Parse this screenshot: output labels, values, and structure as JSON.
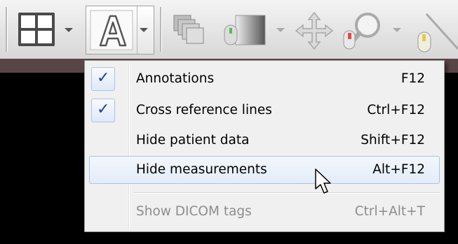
{
  "toolbar": {
    "layout_icon": "grid-layout-icon",
    "annotations_icon": "letter-a-icon",
    "stack_icon": "image-stack-icon",
    "window_level_icon": "window-level-icon",
    "pan_icon": "move-arrows-icon",
    "zoom_icon": "magnifier-icon",
    "measure_icon": "ruler-icon"
  },
  "menu": {
    "items": [
      {
        "label": "Annotations",
        "shortcut": "F12",
        "checked": true
      },
      {
        "label": "Cross reference lines",
        "shortcut": "Ctrl+F12",
        "checked": true
      },
      {
        "label": "Hide patient data",
        "shortcut": "Shift+F12",
        "checked": false
      },
      {
        "label": "Hide measurements",
        "shortcut": "Alt+F12",
        "checked": false,
        "hovered": true
      },
      {
        "label": "Show DICOM tags",
        "shortcut": "Ctrl+Alt+T",
        "checked": false,
        "disabled": true
      }
    ],
    "check_glyph": "✓"
  },
  "colors": {
    "accent_check": "#1d3ea8",
    "hover_border": "#a8c4e8",
    "disabled_text": "#8d8d8d"
  }
}
